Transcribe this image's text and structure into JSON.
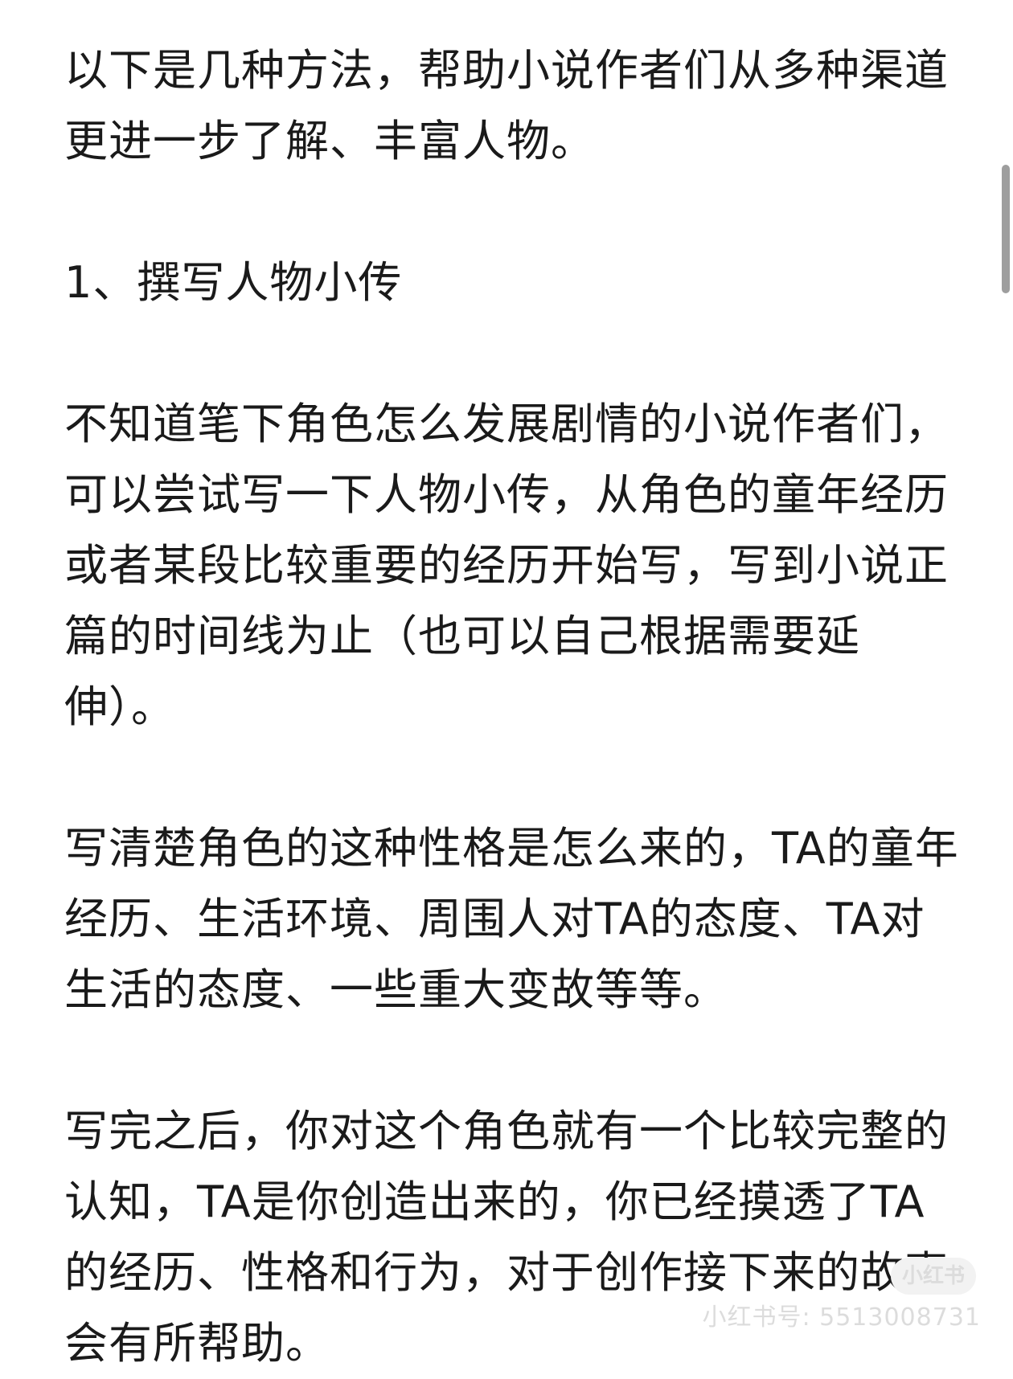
{
  "paragraphs": [
    "以下是几种方法，帮助小说作者们从多种渠道更进一步了解、丰富人物。",
    "1、撰写人物小传",
    "不知道笔下角色怎么发展剧情的小说作者们，可以尝试写一下人物小传，从角色的童年经历或者某段比较重要的经历开始写，写到小说正篇的时间线为止（也可以自己根据需要延伸）。",
    "写清楚角色的这种性格是怎么来的，TA的童年经历、生活环境、周围人对TA的态度、TA对生活的态度、一些重大变故等等。",
    "写完之后，你对这个角色就有一个比较完整的认知，TA是你创造出来的，你已经摸透了TA的经历、性格和行为，对于创作接下来的故事会有所帮助。"
  ],
  "watermark": {
    "badge": "小红书",
    "id_text": "小红书号: 5513008731"
  }
}
